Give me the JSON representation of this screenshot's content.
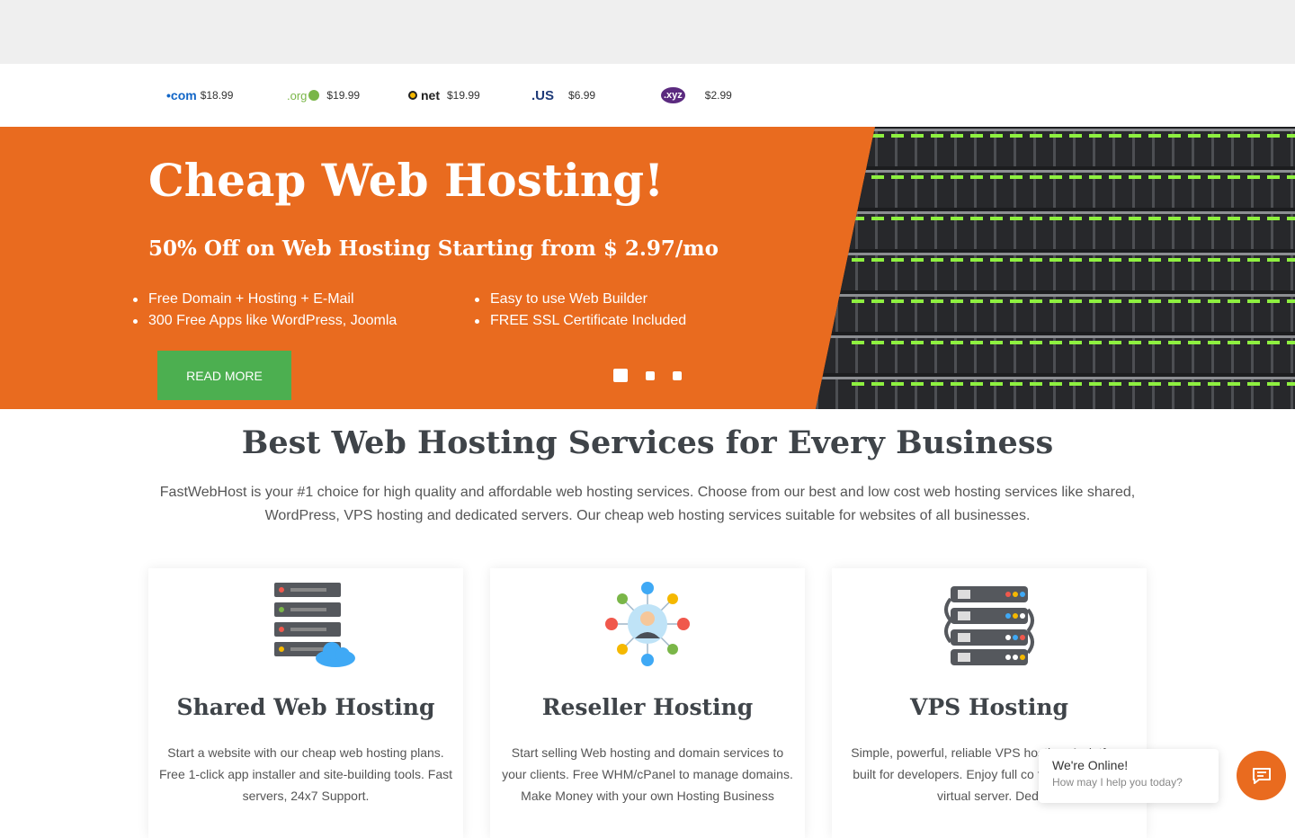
{
  "domains": [
    {
      "tld": "•com",
      "price": "$18.99"
    },
    {
      "tld": ".org",
      "price": "$19.99"
    },
    {
      "tld": "net",
      "price": "$19.99"
    },
    {
      "tld": ".US",
      "price": "$6.99"
    },
    {
      "tld": ".xyz",
      "price": "$2.99"
    }
  ],
  "hero": {
    "title": "Cheap Web Hosting!",
    "subtitle": "50% Off on Web Hosting Starting from $ 2.97/mo",
    "features_left": [
      "Free Domain + Hosting + E-Mail",
      "300 Free Apps like WordPress, Joomla"
    ],
    "features_right": [
      "Easy to use Web Builder",
      "FREE SSL Certificate Included"
    ],
    "button_label": "READ MORE",
    "slide_count": 3,
    "active_slide": 1
  },
  "intro": {
    "title": "Best Web Hosting Services for Every Business",
    "text": "FastWebHost is your #1 choice for high quality and affordable web hosting services. Choose from our best and low cost web hosting services like shared, WordPress, VPS hosting and dedicated servers. Our cheap web hosting services suitable for websites of all businesses."
  },
  "cards": [
    {
      "icon": "server-cloud-icon",
      "title": "Shared Web Hosting",
      "text": "Start a website with our cheap web hosting plans. Free 1-click app installer and site-building tools. Fast servers, 24x7 Support."
    },
    {
      "icon": "reseller-network-icon",
      "title": "Reseller Hosting",
      "text": "Start selling Web hosting and domain services to your clients. Free WHM/cPanel to manage domains. Make Money with your own Hosting Business"
    },
    {
      "icon": "vps-servers-icon",
      "title": "VPS Hosting",
      "text": "Simple, powerful, reliable VPS hosting. A platform built for developers. Enjoy full co freedom of your virtual server. Dedi"
    }
  ],
  "chat": {
    "status": "We're Online!",
    "prompt": "How may I help you today?",
    "icon": "chat-icon",
    "color": "#e96b1f"
  },
  "colors": {
    "hero_bg": "#e96b1f",
    "button_bg": "#4caf50",
    "heading": "#3f4449"
  }
}
